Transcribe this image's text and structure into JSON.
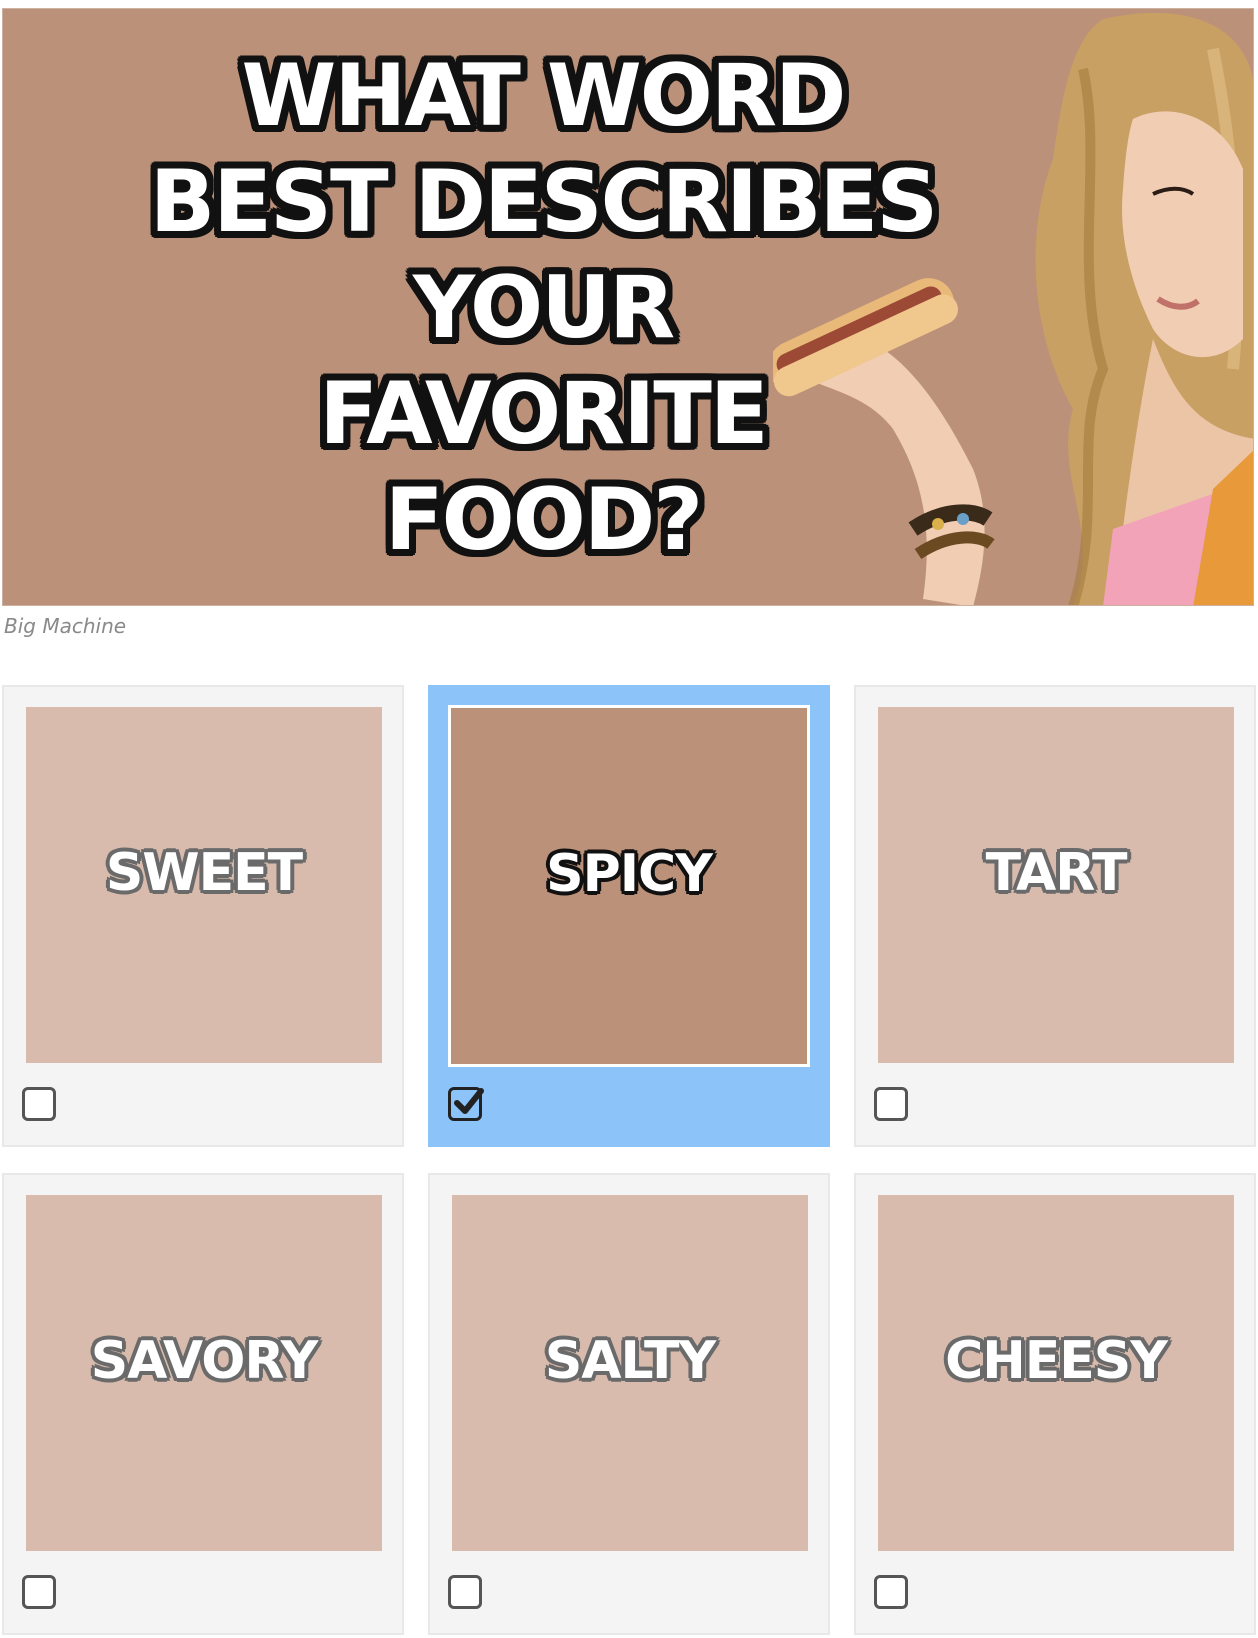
{
  "hero": {
    "title_lines": [
      "WHAT WORD",
      "BEST DESCRIBES",
      "YOUR",
      "FAVORITE",
      "FOOD?"
    ],
    "background_color": "#bc917a"
  },
  "credit": "Big Machine",
  "options": [
    {
      "label": "SWEET",
      "selected": false
    },
    {
      "label": "SPICY",
      "selected": true
    },
    {
      "label": "TART",
      "selected": false
    },
    {
      "label": "SAVORY",
      "selected": false
    },
    {
      "label": "SALTY",
      "selected": false
    },
    {
      "label": "CHEESY",
      "selected": false
    }
  ],
  "colors": {
    "selected_card": "#8cc4fa",
    "tile_unselected": "#d8bbad",
    "tile_selected": "#bc917a"
  }
}
